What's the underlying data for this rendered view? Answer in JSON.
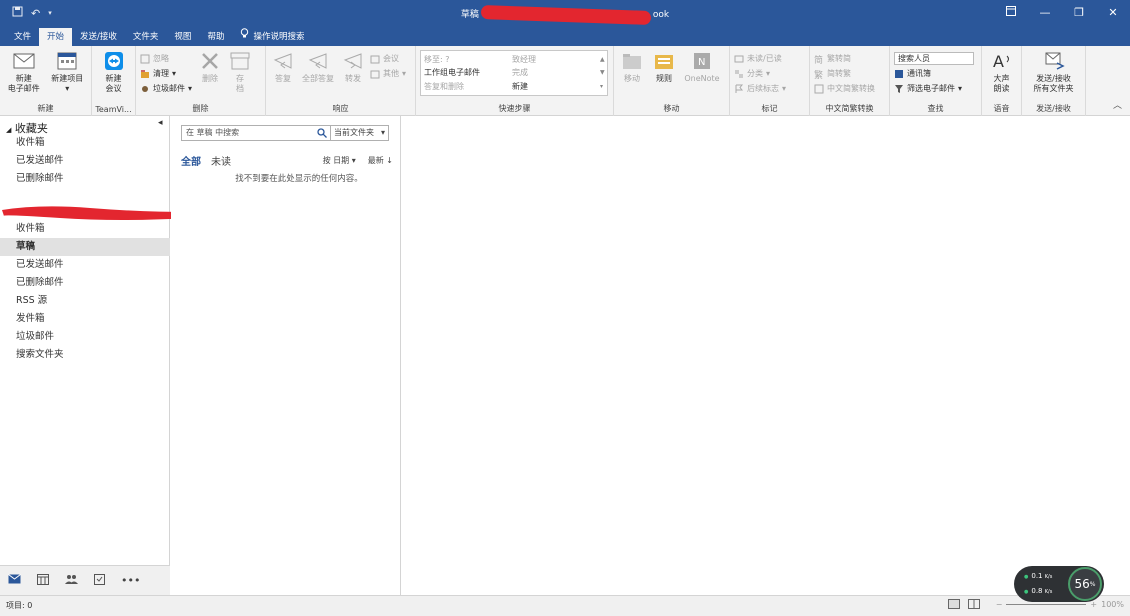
{
  "titlebar": {
    "title_prefix": "草稿",
    "title_suffix": "ook",
    "quick_access": [
      "save-icon",
      "undo-icon",
      "customize-icon"
    ],
    "window_controls": [
      "ribbon-display-icon",
      "minimize-icon",
      "restore-icon",
      "close-icon"
    ]
  },
  "tabs": [
    {
      "label": "文件"
    },
    {
      "label": "开始",
      "active": true
    },
    {
      "label": "发送/接收"
    },
    {
      "label": "文件夹"
    },
    {
      "label": "视图"
    },
    {
      "label": "帮助"
    }
  ],
  "tell_me": "操作说明搜索",
  "ribbon": {
    "new_group": {
      "label": "新建",
      "new_email": "新建\n电子邮件",
      "new_items": "新建项目"
    },
    "teamviewer_group": {
      "label": "TeamVi...",
      "new_meeting": "新建\n会议"
    },
    "delete_group": {
      "label": "删除",
      "ignore": "忽略",
      "cleanup": "清理",
      "junk": "垃圾邮件",
      "delete": "删除",
      "archive": "存\n档"
    },
    "respond_group": {
      "label": "响应",
      "reply": "答复",
      "reply_all": "全部答复",
      "forward": "转发",
      "meeting": "会议",
      "more": "其他"
    },
    "quicksteps_group": {
      "label": "快速步骤",
      "items": [
        "移至: ?",
        "致经理",
        "工作组电子邮件",
        "完成",
        "答复和删除",
        "新建"
      ]
    },
    "move_group": {
      "label": "移动",
      "move": "移动",
      "rules": "规则",
      "onenote": "OneNote"
    },
    "tags_group": {
      "label": "标记",
      "unread_read": "未读/已读",
      "categorize": "分类",
      "followup": "后续标志"
    },
    "convert_group": {
      "label": "中文简繁转换",
      "to_simplified": "繁转简",
      "to_traditional": "简转繁",
      "conversion": "中文简繁转换"
    },
    "find_group": {
      "label": "查找",
      "search_people": "搜索人员",
      "address_book": "通讯簿",
      "filter_email": "筛选电子邮件"
    },
    "speech_group": {
      "label": "语音",
      "read_aloud": "大声\n朗读"
    },
    "sendrecv_group": {
      "label": "发送/接收",
      "send_all": "发送/接收\n所有文件夹"
    }
  },
  "folders": {
    "favorites_header": "收藏夹",
    "favorites": [
      "收件箱",
      "已发送邮件",
      "已删除邮件"
    ],
    "account_folders": [
      {
        "label": "收件箱"
      },
      {
        "label": "草稿",
        "selected": true
      },
      {
        "label": "已发送邮件"
      },
      {
        "label": "已删除邮件"
      },
      {
        "label": "RSS 源"
      },
      {
        "label": "发件箱"
      },
      {
        "label": "垃圾邮件"
      },
      {
        "label": "搜索文件夹"
      }
    ]
  },
  "nav_icons": [
    "mail-icon",
    "calendar-icon",
    "people-icon",
    "tasks-icon",
    "more-icon"
  ],
  "message_list": {
    "search_placeholder": "在 草稿 中搜索",
    "scope": "当前文件夹",
    "filter_all": "全部",
    "filter_unread": "未读",
    "sort_by": "按 日期",
    "sort_order": "最新",
    "empty_text": "找不到要在此处显示的任何内容。"
  },
  "status": {
    "items": "项目: 0",
    "zoom": "100%"
  },
  "net_widget": {
    "up_rate": "0.1",
    "down_rate": "0.8",
    "unit": "K/s",
    "percent": "56",
    "percent_sign": "%"
  },
  "colors": {
    "accent": "#2b579a",
    "ribbon_bg": "#f3f3f3",
    "redaction": "#e3262f"
  }
}
